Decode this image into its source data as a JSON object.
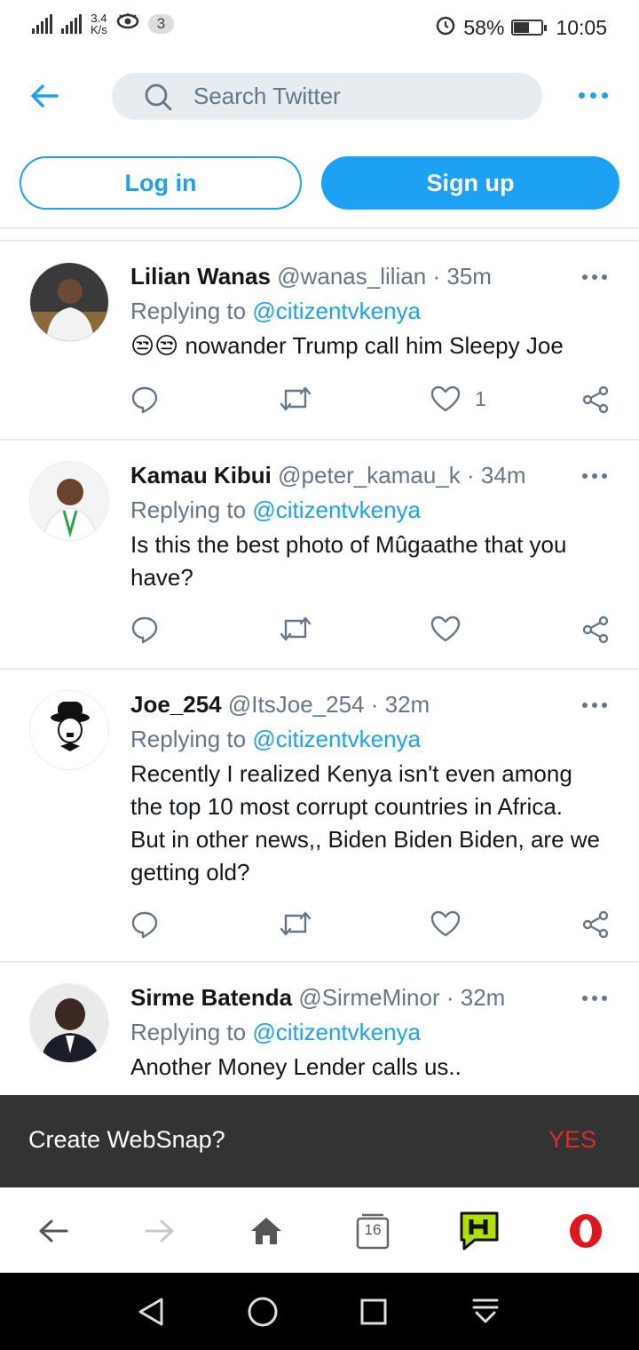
{
  "status_bar": {
    "network_speed_value": "3.4",
    "network_speed_unit": "K/s",
    "notification_count": "3",
    "battery": "58%",
    "battery_level": 0.58,
    "time": "10:05"
  },
  "header": {
    "search_placeholder": "Search Twitter"
  },
  "auth": {
    "login_label": "Log in",
    "signup_label": "Sign up"
  },
  "tweets": [
    {
      "name": "Lilian Wanas",
      "handle": "@wanas_lilian",
      "sep": "·",
      "time": "35m",
      "replying_prefix": "Replying to",
      "replying_to": "@citizentvkenya",
      "emojis": "😒😒",
      "text": "nowander Trump call him Sleepy Joe",
      "like_count": "1"
    },
    {
      "name": "Kamau Kibui",
      "handle": "@peter_kamau_k",
      "sep": "·",
      "time": "34m",
      "replying_prefix": "Replying to",
      "replying_to": "@citizentvkenya",
      "text": "Is this the best photo of Mûgaathe that you have?"
    },
    {
      "name": "Joe_254",
      "handle": "@ItsJoe_254",
      "sep": "·",
      "time": "32m",
      "replying_prefix": "Replying to",
      "replying_to": "@citizentvkenya",
      "text": "Recently I realized Kenya isn't even among the top 10 most corrupt countries in Africa. But in other news,, Biden Biden Biden, are we getting old?"
    },
    {
      "name": "Sirme Batenda",
      "handle": "@SirmeMinor",
      "sep": "·",
      "time": "32m",
      "replying_prefix": "Replying to",
      "replying_to": "@citizentvkenya",
      "text": "Another Money Lender calls us.."
    }
  ],
  "snackbar": {
    "message": "Create WebSnap?",
    "action": "YES"
  },
  "browser_bar": {
    "tab_count": "16"
  },
  "colors": {
    "twitter_blue": "#1da1f2",
    "secondary_text": "#657786",
    "opera_red": "#e0161c",
    "hype_green": "#aee100"
  }
}
